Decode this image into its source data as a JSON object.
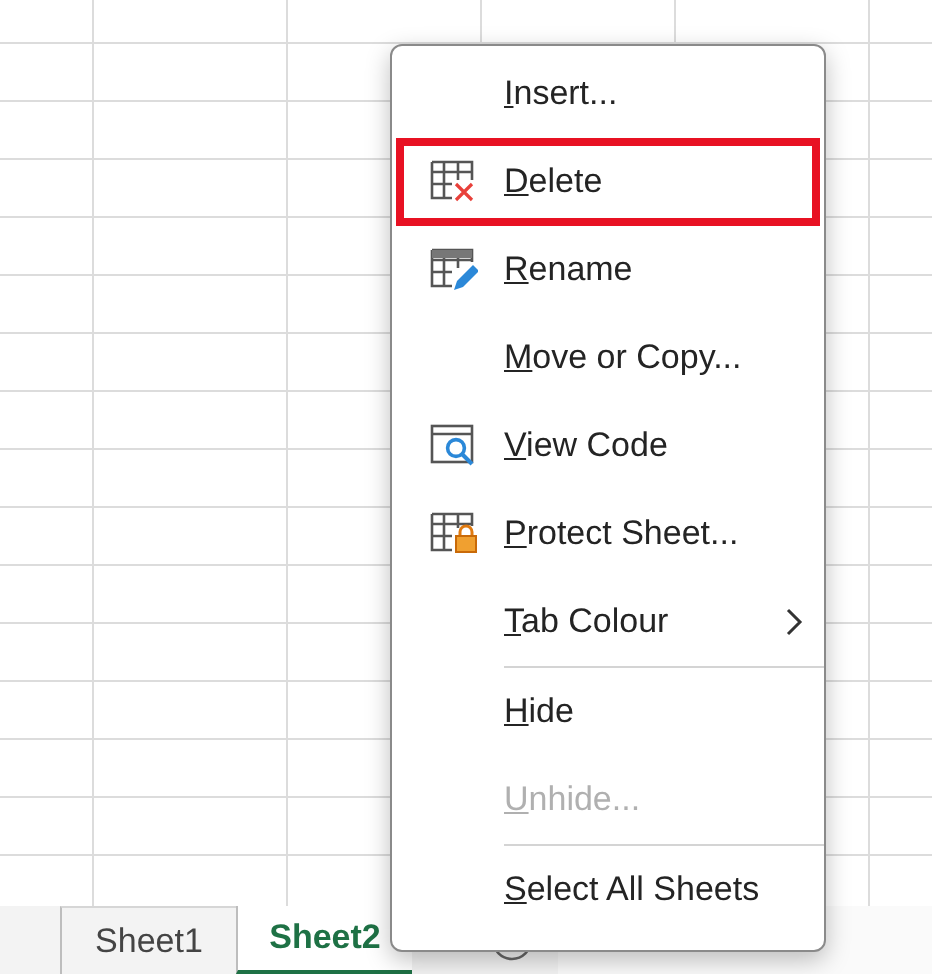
{
  "sheet_tabs": [
    {
      "label": "Sheet1",
      "selected": false
    },
    {
      "label": "Sheet2",
      "selected": true
    }
  ],
  "context_menu": {
    "items": [
      {
        "kind": "item",
        "label": "Insert...",
        "underlined_first_letter": true,
        "disabled": false,
        "highlighted": false
      },
      {
        "kind": "item",
        "label": "Delete",
        "underlined_first_letter": true,
        "disabled": false,
        "highlighted": true
      },
      {
        "kind": "item",
        "label": "Rename",
        "underlined_first_letter": true,
        "disabled": false,
        "highlighted": false
      },
      {
        "kind": "item",
        "label": "Move or Copy...",
        "underlined_first_letter": true,
        "disabled": false,
        "highlighted": false
      },
      {
        "kind": "item",
        "label": "View Code",
        "underlined_first_letter": true,
        "disabled": false,
        "highlighted": false
      },
      {
        "kind": "item",
        "label": "Protect Sheet...",
        "underlined_first_letter": true,
        "disabled": false,
        "highlighted": false
      },
      {
        "kind": "submenu",
        "label": "Tab Colour",
        "underlined_first_letter": true,
        "disabled": false,
        "highlighted": false
      },
      {
        "kind": "separator"
      },
      {
        "kind": "item",
        "label": "Hide",
        "underlined_first_letter": true,
        "disabled": false,
        "highlighted": false
      },
      {
        "kind": "item",
        "label": "Unhide...",
        "underlined_first_letter": true,
        "disabled": true,
        "highlighted": false
      },
      {
        "kind": "separator"
      },
      {
        "kind": "item",
        "label": "Select All Sheets",
        "underlined_first_letter": true,
        "disabled": false,
        "highlighted": false
      }
    ]
  }
}
